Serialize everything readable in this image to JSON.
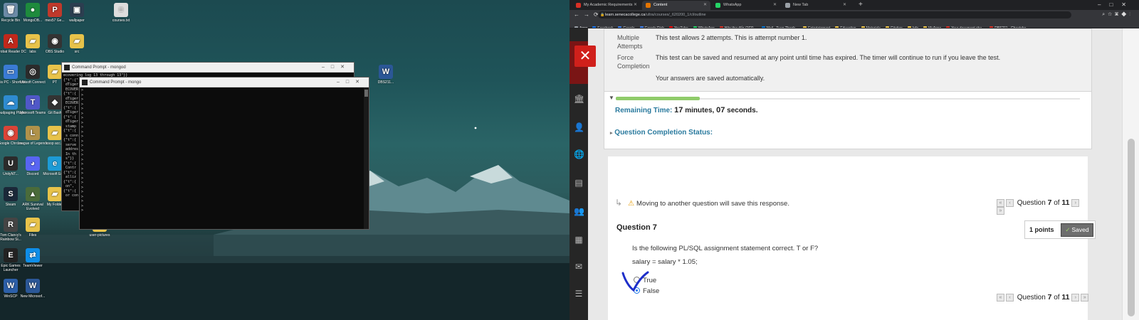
{
  "desktop": {
    "icons": [
      {
        "label": "Recycle Bin",
        "color": "#6c8aa6",
        "glyph": "🗑"
      },
      {
        "label": "MongoDB...",
        "color": "#1e8b3d",
        "glyph": "●"
      },
      {
        "label": "mes57 Ge...",
        "color": "#c0392b",
        "glyph": "P"
      },
      {
        "label": "wallpaper",
        "color": "#2c3e50",
        "glyph": "▣"
      },
      {
        "label": "courses.txt",
        "color": "#dddddd",
        "glyph": "≡"
      },
      {
        "label": "Acrobat Reader DC",
        "color": "#c0281b",
        "glyph": "A"
      },
      {
        "label": "labs",
        "color": "#e8c34a",
        "glyph": "▰"
      },
      {
        "label": "OBS Studio",
        "color": "#333333",
        "glyph": "◉"
      },
      {
        "label": "src",
        "color": "#e8c34a",
        "glyph": "▰"
      },
      {
        "label": "This PC - Shortcut",
        "color": "#3a7bd5",
        "glyph": "▭"
      },
      {
        "label": "Ubisoft Connect",
        "color": "#2b2b2b",
        "glyph": "◎"
      },
      {
        "label": "PT",
        "color": "#e8c34a",
        "glyph": "▰"
      },
      {
        "label": "Cloudpaging Player",
        "color": "#2e8bd0",
        "glyph": "☁"
      },
      {
        "label": "Microsoft Teams",
        "color": "#5058c8",
        "glyph": "T"
      },
      {
        "label": "Git Bash",
        "color": "#333333",
        "glyph": "◆"
      },
      {
        "label": "Google Chrome",
        "color": "#db4437",
        "glyph": "◉"
      },
      {
        "label": "League of Legends",
        "color": "#b0924a",
        "glyph": "L"
      },
      {
        "label": "csop acc...",
        "color": "#e8c34a",
        "glyph": "▰"
      },
      {
        "label": "UnityNT...",
        "color": "#2b2b2b",
        "glyph": "U"
      },
      {
        "label": "Discord",
        "color": "#5865f2",
        "glyph": "◕"
      },
      {
        "label": "Microsoft Edge",
        "color": "#1d9bd6",
        "glyph": "e"
      },
      {
        "label": "Steam",
        "color": "#1b2838",
        "glyph": "S"
      },
      {
        "label": "ARK Survival Evolved",
        "color": "#4a6b3a",
        "glyph": "▲"
      },
      {
        "label": "My Folder",
        "color": "#e8c34a",
        "glyph": "▰"
      },
      {
        "label": "Tom Clancy's Rainbow Si...",
        "color": "#444444",
        "glyph": "R"
      },
      {
        "label": "Files",
        "color": "#e8c34a",
        "glyph": "▰"
      },
      {
        "label": "Epic Games Launcher",
        "color": "#222222",
        "glyph": "E"
      },
      {
        "label": "TeamViewer",
        "color": "#0e8ee9",
        "glyph": "⇄"
      },
      {
        "label": "WinSCP",
        "color": "#2c5fa8",
        "glyph": "W"
      },
      {
        "label": "New Microsof...",
        "color": "#2b5797",
        "glyph": "W"
      },
      {
        "label": "user-pictures",
        "color": "#e8c34a",
        "glyph": "▰"
      },
      {
        "label": "DBS211...",
        "color": "#2b5797",
        "glyph": "W"
      }
    ],
    "cmd_back": {
      "title": "Command Prompt - mongod",
      "lines": "ecovering log 13 through 13\"}}\n{\"t\":{\"\n dTiger\n ECOVER\n{\"t\":{\n dTiger\n ECOVER\n{\"t\":{\n dTiger\n{\"t\":{\n dTiger\n stamp\n{\"t\":{\n s conn\n{\"t\":{\n serve\n addres\n In th\n s\"}}\n{\"t\":{\n Contr\n{\"t\":{\n alliz\n{\"t\":{\n on\",\n{\"t\":{\n or con"
    },
    "cmd_front": {
      "title": "Command Prompt - mongo",
      "lines": ">\n>\n>\n>\n>\n>\n>\n>\n>\n>\n>\n>\n>\n>\n>\n>\n>\n>\n>\n>\n>\n>\n>\n>\n>\n>\n>"
    }
  },
  "browser": {
    "tabs": [
      {
        "label": "My Academic Requirements",
        "color": "#d93025",
        "active": false
      },
      {
        "label": "Content",
        "color": "#e37400",
        "active": true
      },
      {
        "label": "WhatsApp",
        "color": "#25d366",
        "active": false
      },
      {
        "label": "New Tab",
        "color": "#9aa0a6",
        "active": false
      }
    ],
    "url_host": "learn.senecacollege.ca",
    "url_path": "/ultra/courses/_620200_1/cl/outline",
    "bookmarks": [
      {
        "label": "Apps",
        "color": "#9aa0a6"
      },
      {
        "label": "Facebook",
        "color": "#1877f2"
      },
      {
        "label": "Google",
        "color": "#4285f4"
      },
      {
        "label": "Google Dịch",
        "color": "#4285f4"
      },
      {
        "label": "YouTube",
        "color": "#ff0000"
      },
      {
        "label": "WhatsApp",
        "color": "#25d366"
      },
      {
        "label": "Hộp thư đến (163)...",
        "color": "#d93025"
      },
      {
        "label": "Mail - Tuan Thanh...",
        "color": "#0078d4"
      },
      {
        "label": "Entertainment",
        "color": "#f2c94c"
      },
      {
        "label": "Education",
        "color": "#f2c94c"
      },
      {
        "label": "Materials",
        "color": "#f2c94c"
      },
      {
        "label": "Citation",
        "color": "#f2c94c"
      },
      {
        "label": "Info",
        "color": "#f2c94c"
      },
      {
        "label": "MyApps",
        "color": "#f2c94c"
      },
      {
        "label": "Your document cha...",
        "color": "#d93025"
      },
      {
        "label": "DBS211 - Cheatshe...",
        "color": "#d93025"
      }
    ]
  },
  "test": {
    "multiple_attempts_label": "Multiple Attempts",
    "multiple_attempts_value": "This test allows 2 attempts. This is attempt number 1.",
    "force_completion_label": "Force Completion",
    "force_completion_value": "This test can be saved and resumed at any point until time has expired. The timer will continue to run if you leave the test.",
    "autosave_note": "Your answers are saved automatically.",
    "remaining_label": "Remaining Time:",
    "remaining_minutes": "17",
    "minutes_unit": "minutes,",
    "remaining_seconds": "07",
    "seconds_unit": "seconds.",
    "timer_progress": 0.18,
    "completion_status_label": "Question Completion Status:",
    "save_msg": "Moving to another question will save this response.",
    "question_word": "Question",
    "current_question": "7",
    "of_word": "of",
    "total_questions": "11",
    "question_title": "Question 7",
    "points": "1 points",
    "saved_label": "Saved",
    "question_text": "Is the following PL/SQL assignment statement correct. T or F?",
    "statement": "salary = salary * 1.05;",
    "option_true": "True",
    "option_false": "False",
    "selected": "False"
  }
}
